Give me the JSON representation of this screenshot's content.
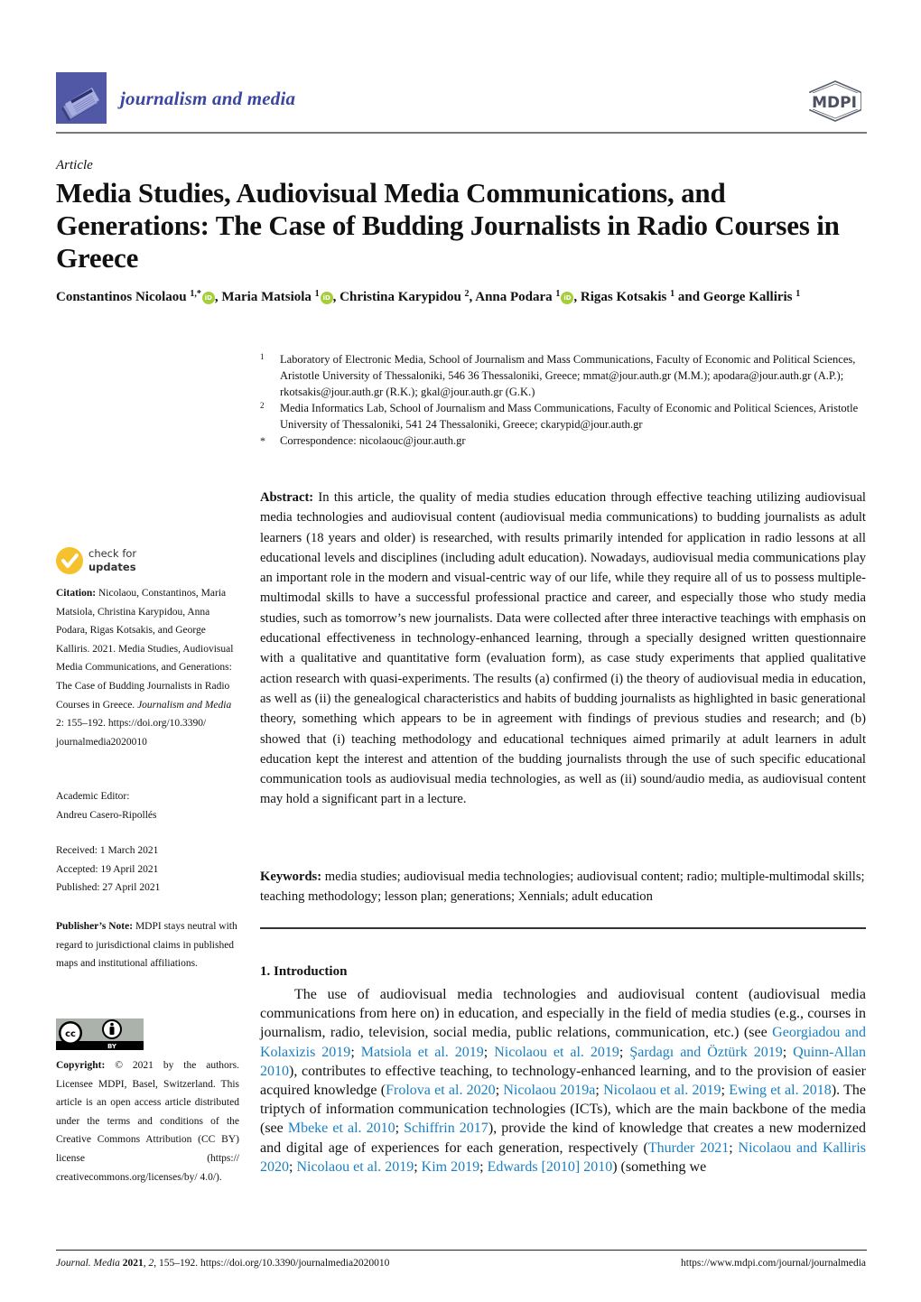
{
  "header": {
    "journal_name": "journalism and media",
    "publisher_logo": "MDPI",
    "colors": {
      "journal_blue": "#3a45a0",
      "logo_bg": "#5159a6",
      "link_blue": "#1a7fc1",
      "orcid_green": "#a6ce39",
      "check_yellow": "#f5c22e"
    }
  },
  "article": {
    "type": "Article",
    "title": "Media Studies, Audiovisual Media Communications, and Generations: The Case of Budding Journalists in Radio Courses in Greece",
    "authors": [
      {
        "name": "Constantinos Nicolaou",
        "sup": "1,*",
        "orcid": true
      },
      {
        "name": "Maria Matsiola",
        "sup": "1",
        "orcid": true
      },
      {
        "name": "Christina Karypidou",
        "sup": "2",
        "orcid": false
      },
      {
        "name": "Anna Podara",
        "sup": "1",
        "orcid": true
      },
      {
        "name": "Rigas Kotsakis",
        "sup": "1",
        "orcid": false
      },
      {
        "name": "George Kalliris",
        "sup": "1",
        "orcid": false
      }
    ],
    "author_separator": ", ",
    "author_last_join": " and",
    "affiliations": [
      {
        "marker": "1",
        "text": "Laboratory of Electronic Media, School of Journalism and Mass Communications, Faculty of Economic and Political Sciences, Aristotle University of Thessaloniki, 546 36 Thessaloniki, Greece; mmat@jour.auth.gr (M.M.); apodara@jour.auth.gr (A.P.); rkotsakis@jour.auth.gr (R.K.); gkal@jour.auth.gr (G.K.)"
      },
      {
        "marker": "2",
        "text": "Media Informatics Lab, School of Journalism and Mass Communications, Faculty of Economic and Political Sciences, Aristotle University of Thessaloniki, 541 24 Thessaloniki, Greece; ckarypid@jour.auth.gr"
      },
      {
        "marker": "*",
        "text": "Correspondence: nicolaouc@jour.auth.gr"
      }
    ]
  },
  "sidebar": {
    "check_updates": {
      "line1": "check for",
      "line2": "updates"
    },
    "citation": {
      "label": "Citation:",
      "text_before": " Nicolaou, Constantinos, Maria Matsiola, Christina Karypidou, Anna Podara, Rigas Kotsakis, and George Kalliris. 2021. Media Studies, Audiovisual Media Communications, and Generations: The Case of Budding Journalists in Radio Courses in Greece. ",
      "journal_italic": "Journalism and Media",
      "text_after": " 2: 155–192. https://doi.org/10.3390/ journalmedia2020010"
    },
    "editor": {
      "label": "Academic Editor:",
      "name": "Andreu Casero-Ripollés"
    },
    "dates": [
      "Received: 1 March 2021",
      "Accepted: 19 April 2021",
      "Published: 27 April 2021"
    ],
    "publisher_note": {
      "label": "Publisher’s Note:",
      "text": " MDPI stays neutral with regard to jurisdictional claims in published maps and institutional affiliations."
    },
    "license_badge": {
      "cc": "cc",
      "by": "BY"
    },
    "copyright": {
      "label": "Copyright:",
      "text": " © 2021 by the authors. Licensee MDPI, Basel, Switzerland. This article is an open access article distributed under the terms and conditions of the Creative Commons Attribution (CC BY) license (https:// creativecommons.org/licenses/by/ 4.0/)."
    }
  },
  "abstract": {
    "label": "Abstract:",
    "text": " In this article, the quality of media studies education through effective teaching utilizing audiovisual media technologies and audiovisual content (audiovisual media communications) to budding journalists as adult learners (18 years and older) is researched, with results primarily intended for application in radio lessons at all educational levels and disciplines (including adult education). Nowadays, audiovisual media communications play an important role in the modern and visual-centric way of our life, while they require all of us to possess multiple-multimodal skills to have a successful professional practice and career, and especially those who study media studies, such as tomorrow’s new journalists. Data were collected after three interactive teachings with emphasis on educational effectiveness in technology-enhanced learning, through a specially designed written questionnaire with a qualitative and quantitative form (evaluation form), as case study experiments that applied qualitative action research with quasi-experiments. The results (a) confirmed (i) the theory of audiovisual media in education, as well as (ii) the genealogical characteristics and habits of budding journalists as highlighted in basic generational theory, something which appears to be in agreement with findings of previous studies and research; and (b) showed that (i) teaching methodology and educational techniques aimed primarily at adult learners in adult education kept the interest and attention of the budding journalists through the use of such specific educational communication tools as audiovisual media technologies, as well as (ii) sound/audio media, as audiovisual content may hold a significant part in a lecture."
  },
  "keywords": {
    "label": "Keywords:",
    "text": " media studies; audiovisual media technologies; audiovisual content; radio; multiple-multimodal skills; teaching methodology; lesson plan; generations; Xennials; adult education"
  },
  "introduction": {
    "heading": "1. Introduction",
    "segments": [
      {
        "t": "The use of audiovisual media technologies and audiovisual content (audiovisual media communications from here on) in education, and especially in the field of media studies (e.g., courses in journalism, radio, television, social media, public relations, communication, etc.) (see ",
        "ref": false
      },
      {
        "t": "Georgiadou and Kolaxizis 2019",
        "ref": true
      },
      {
        "t": "; ",
        "ref": false
      },
      {
        "t": "Matsiola et al. 2019",
        "ref": true
      },
      {
        "t": "; ",
        "ref": false
      },
      {
        "t": "Nicolaou et al. 2019",
        "ref": true
      },
      {
        "t": "; ",
        "ref": false
      },
      {
        "t": "Şardagı and Öztürk 2019",
        "ref": true
      },
      {
        "t": "; ",
        "ref": false
      },
      {
        "t": "Quinn-Allan 2010",
        "ref": true
      },
      {
        "t": "), contributes to effective teaching, to technology-enhanced learning, and to the provision of easier acquired knowledge (",
        "ref": false
      },
      {
        "t": "Frolova et al. 2020",
        "ref": true
      },
      {
        "t": "; ",
        "ref": false
      },
      {
        "t": "Nicolaou 2019a",
        "ref": true
      },
      {
        "t": "; ",
        "ref": false
      },
      {
        "t": "Nicolaou et al. 2019",
        "ref": true
      },
      {
        "t": "; ",
        "ref": false
      },
      {
        "t": "Ewing et al. 2018",
        "ref": true
      },
      {
        "t": "). The triptych of information communication technologies (ICTs), which are the main backbone of the media (see ",
        "ref": false
      },
      {
        "t": "Mbeke et al. 2010",
        "ref": true
      },
      {
        "t": "; ",
        "ref": false
      },
      {
        "t": "Schiffrin 2017",
        "ref": true
      },
      {
        "t": "), provide the kind of knowledge that creates a new modernized and digital age of experiences for each generation, respectively (",
        "ref": false
      },
      {
        "t": "Thurder 2021",
        "ref": true
      },
      {
        "t": "; ",
        "ref": false
      },
      {
        "t": "Nicolaou and Kalliris 2020",
        "ref": true
      },
      {
        "t": "; ",
        "ref": false
      },
      {
        "t": "Nicolaou et al. 2019",
        "ref": true
      },
      {
        "t": "; ",
        "ref": false
      },
      {
        "t": "Kim 2019",
        "ref": true
      },
      {
        "t": "; ",
        "ref": false
      },
      {
        "t": "Edwards [2010] 2010",
        "ref": true
      },
      {
        "t": ") (something we",
        "ref": false
      }
    ]
  },
  "footer": {
    "journal_abbrev": "Journal. Media",
    "year": "2021",
    "volume": "2",
    "pages_doi": ", 155–192. https://doi.org/10.3390/journalmedia2020010",
    "url": "https://www.mdpi.com/journal/journalmedia"
  }
}
